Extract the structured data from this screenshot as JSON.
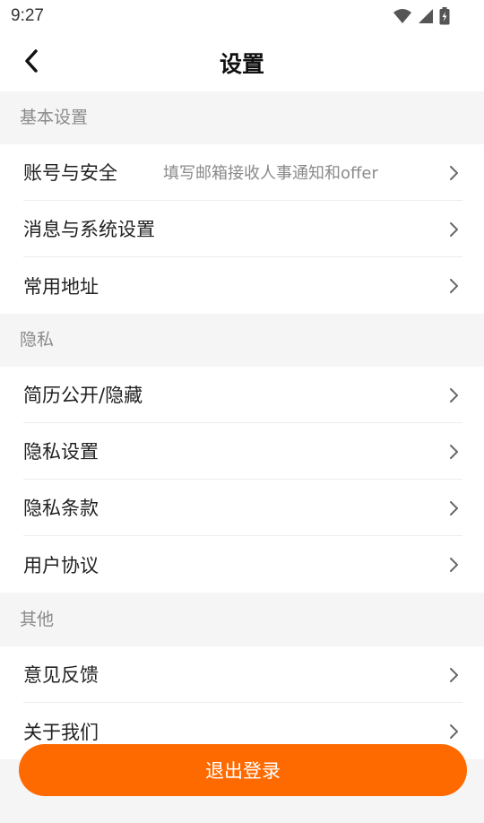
{
  "status_bar": {
    "time": "9:27"
  },
  "nav": {
    "title": "设置"
  },
  "sections": [
    {
      "header": "基本设置",
      "items": [
        {
          "label": "账号与安全",
          "hint": "填写邮箱接收人事通知和offer"
        },
        {
          "label": "消息与系统设置"
        },
        {
          "label": "常用地址"
        }
      ]
    },
    {
      "header": "隐私",
      "items": [
        {
          "label": "简历公开/隐藏"
        },
        {
          "label": "隐私设置"
        },
        {
          "label": "隐私条款"
        },
        {
          "label": "用户协议"
        }
      ]
    },
    {
      "header": "其他",
      "items": [
        {
          "label": "意见反馈"
        },
        {
          "label": "关于我们"
        }
      ]
    }
  ],
  "logout": {
    "label": "退出登录"
  },
  "colors": {
    "accent": "#ff6a00",
    "section_bg": "#f5f5f5",
    "card_bg": "#ffffff"
  },
  "icons": [
    "wifi-icon",
    "cellular-signal-icon",
    "battery-charging-icon",
    "back-arrow-icon",
    "chevron-right-icon"
  ]
}
